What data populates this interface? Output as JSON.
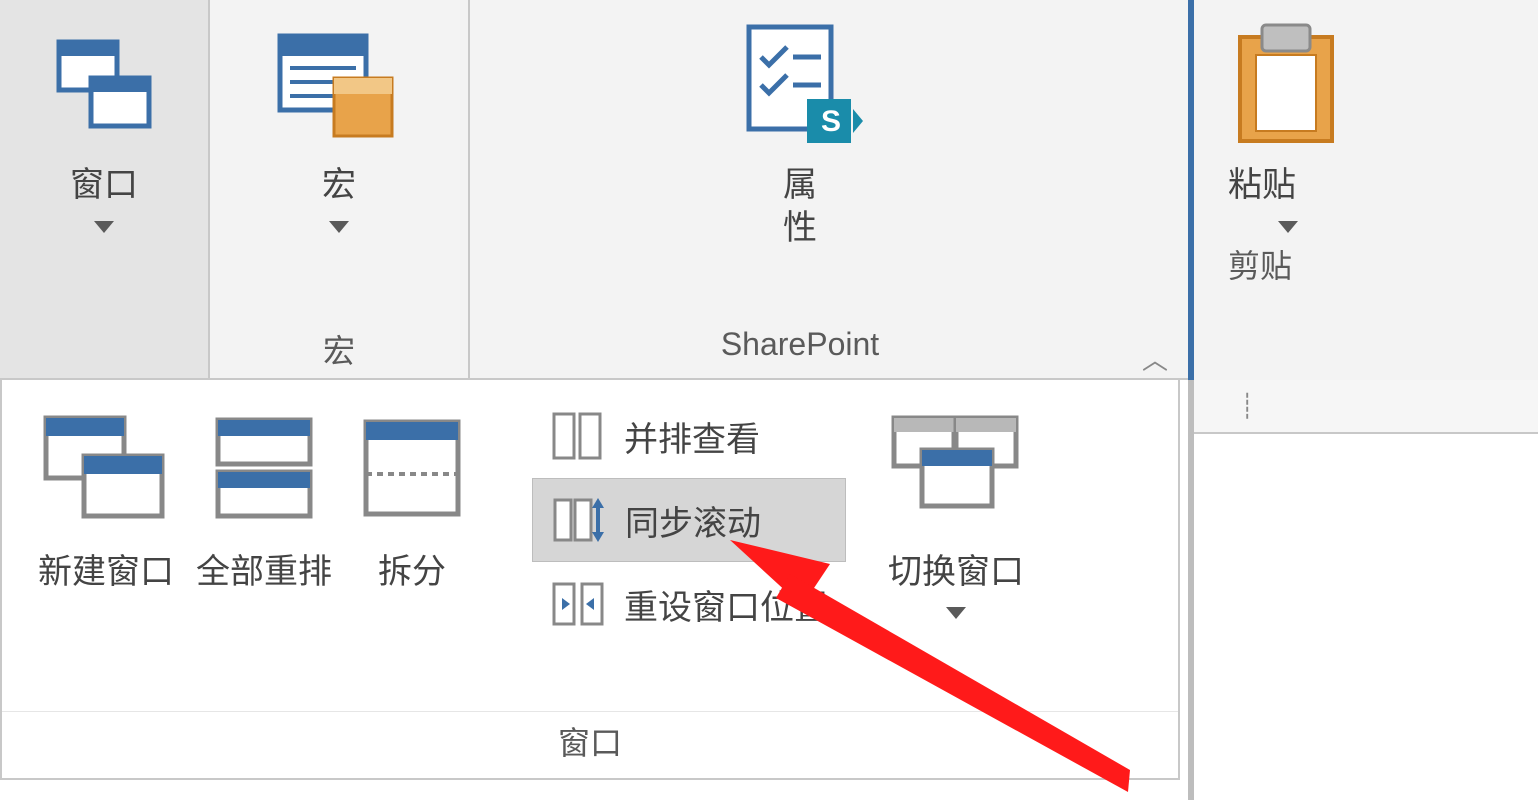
{
  "ribbon": {
    "window_btn": "窗口",
    "macro_btn": "宏",
    "macro_group_label": "宏",
    "properties_btn": "属\n性",
    "sharepoint_group_label": "SharePoint",
    "paste_btn": "粘贴",
    "clipboard_group_label": "剪贴"
  },
  "dropdown": {
    "new_window": "新建窗口",
    "arrange_all": "全部重排",
    "split": "拆分",
    "view_side_by_side": "并排查看",
    "sync_scroll": "同步滚动",
    "reset_position": "重设窗口位置",
    "switch_window": "切换窗口",
    "group_label": "窗口"
  },
  "colors": {
    "accent_blue": "#3b6fa8",
    "icon_orange": "#e8a34a",
    "sp_teal": "#1a8caa",
    "arrow_red": "#ff1a1a"
  }
}
